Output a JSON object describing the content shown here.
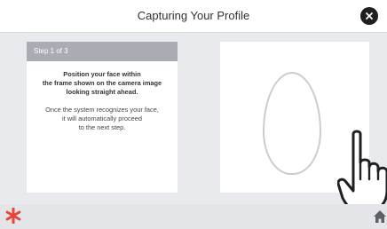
{
  "header": {
    "title": "Capturing Your Profile",
    "close_icon": "close-icon"
  },
  "instructions": {
    "step": "Step 1 of 3",
    "line1": "Position your face within",
    "line2": "the frame shown on the camera image",
    "line3": "looking straight ahead.",
    "line4": "Once the system recognizes your face,",
    "line5": "it will automatically proceed",
    "line6": "to the next step."
  },
  "camera": {
    "frame_icon": "face-oval-frame",
    "hand_icon": "pointing-hand-icon"
  },
  "footer": {
    "left_icon": "asterisk-icon",
    "right_icon": "home-icon"
  },
  "colors": {
    "accent": "#e5473d",
    "titlebar": "#ffffff",
    "step_header": "#a9acb2"
  }
}
